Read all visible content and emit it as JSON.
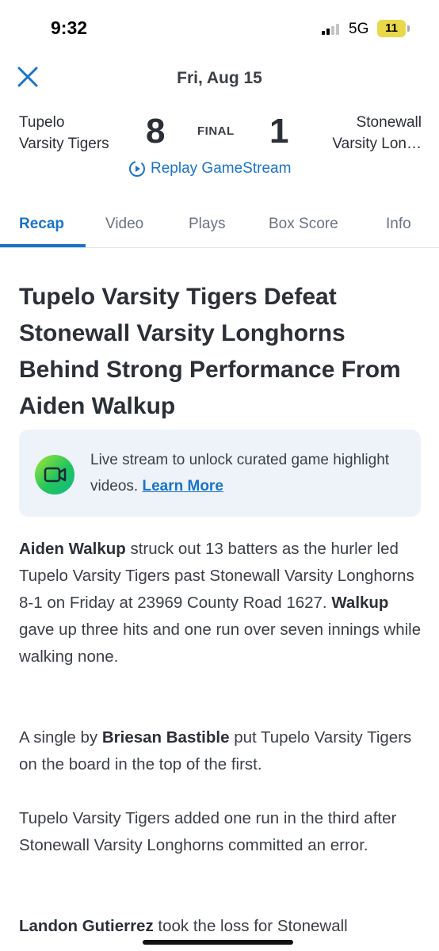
{
  "status_bar": {
    "time": "9:32",
    "network": "5G",
    "battery": "11"
  },
  "header": {
    "date": "Fri, Aug 15"
  },
  "game": {
    "home_team_line1": "Tupelo",
    "home_team_line2": "Varsity Tigers",
    "home_score": "8",
    "status": "FINAL",
    "away_score": "1",
    "away_team_line1": "Stonewall",
    "away_team_line2": "Varsity Lon…",
    "replay_label": "Replay GameStream"
  },
  "tabs": [
    {
      "label": "Recap",
      "active": true
    },
    {
      "label": "Video",
      "active": false
    },
    {
      "label": "Plays",
      "active": false
    },
    {
      "label": "Box Score",
      "active": false
    },
    {
      "label": "Info",
      "active": false
    }
  ],
  "article": {
    "headline": "Tupelo Varsity Tigers Defeat Stonewall Varsity Longhorns Behind Strong Performance From Aiden Walkup",
    "callout_text": "Live stream to unlock curated game highlight videos.",
    "callout_link": "Learn More",
    "p1": {
      "name1": "Aiden Walkup",
      "text1": " struck out 13 batters as the hurler led Tupelo Varsity Tigers past Stonewall Varsity Longhorns 8-1 on Friday at 23969 County Road 1627. ",
      "name2": "Walkup",
      "text2": " gave up three hits and one run over seven innings while walking none."
    },
    "p2": {
      "text1": "A single by ",
      "name": "Briesan Bastible",
      "text2": " put Tupelo Varsity Tigers on the board in the top of the first."
    },
    "p3": "Tupelo Varsity Tigers added one run in the third after Stonewall Varsity Longhorns committed an error.",
    "p4": {
      "name": "Landon Gutierrez",
      "text": " took the loss for Stonewall"
    }
  }
}
